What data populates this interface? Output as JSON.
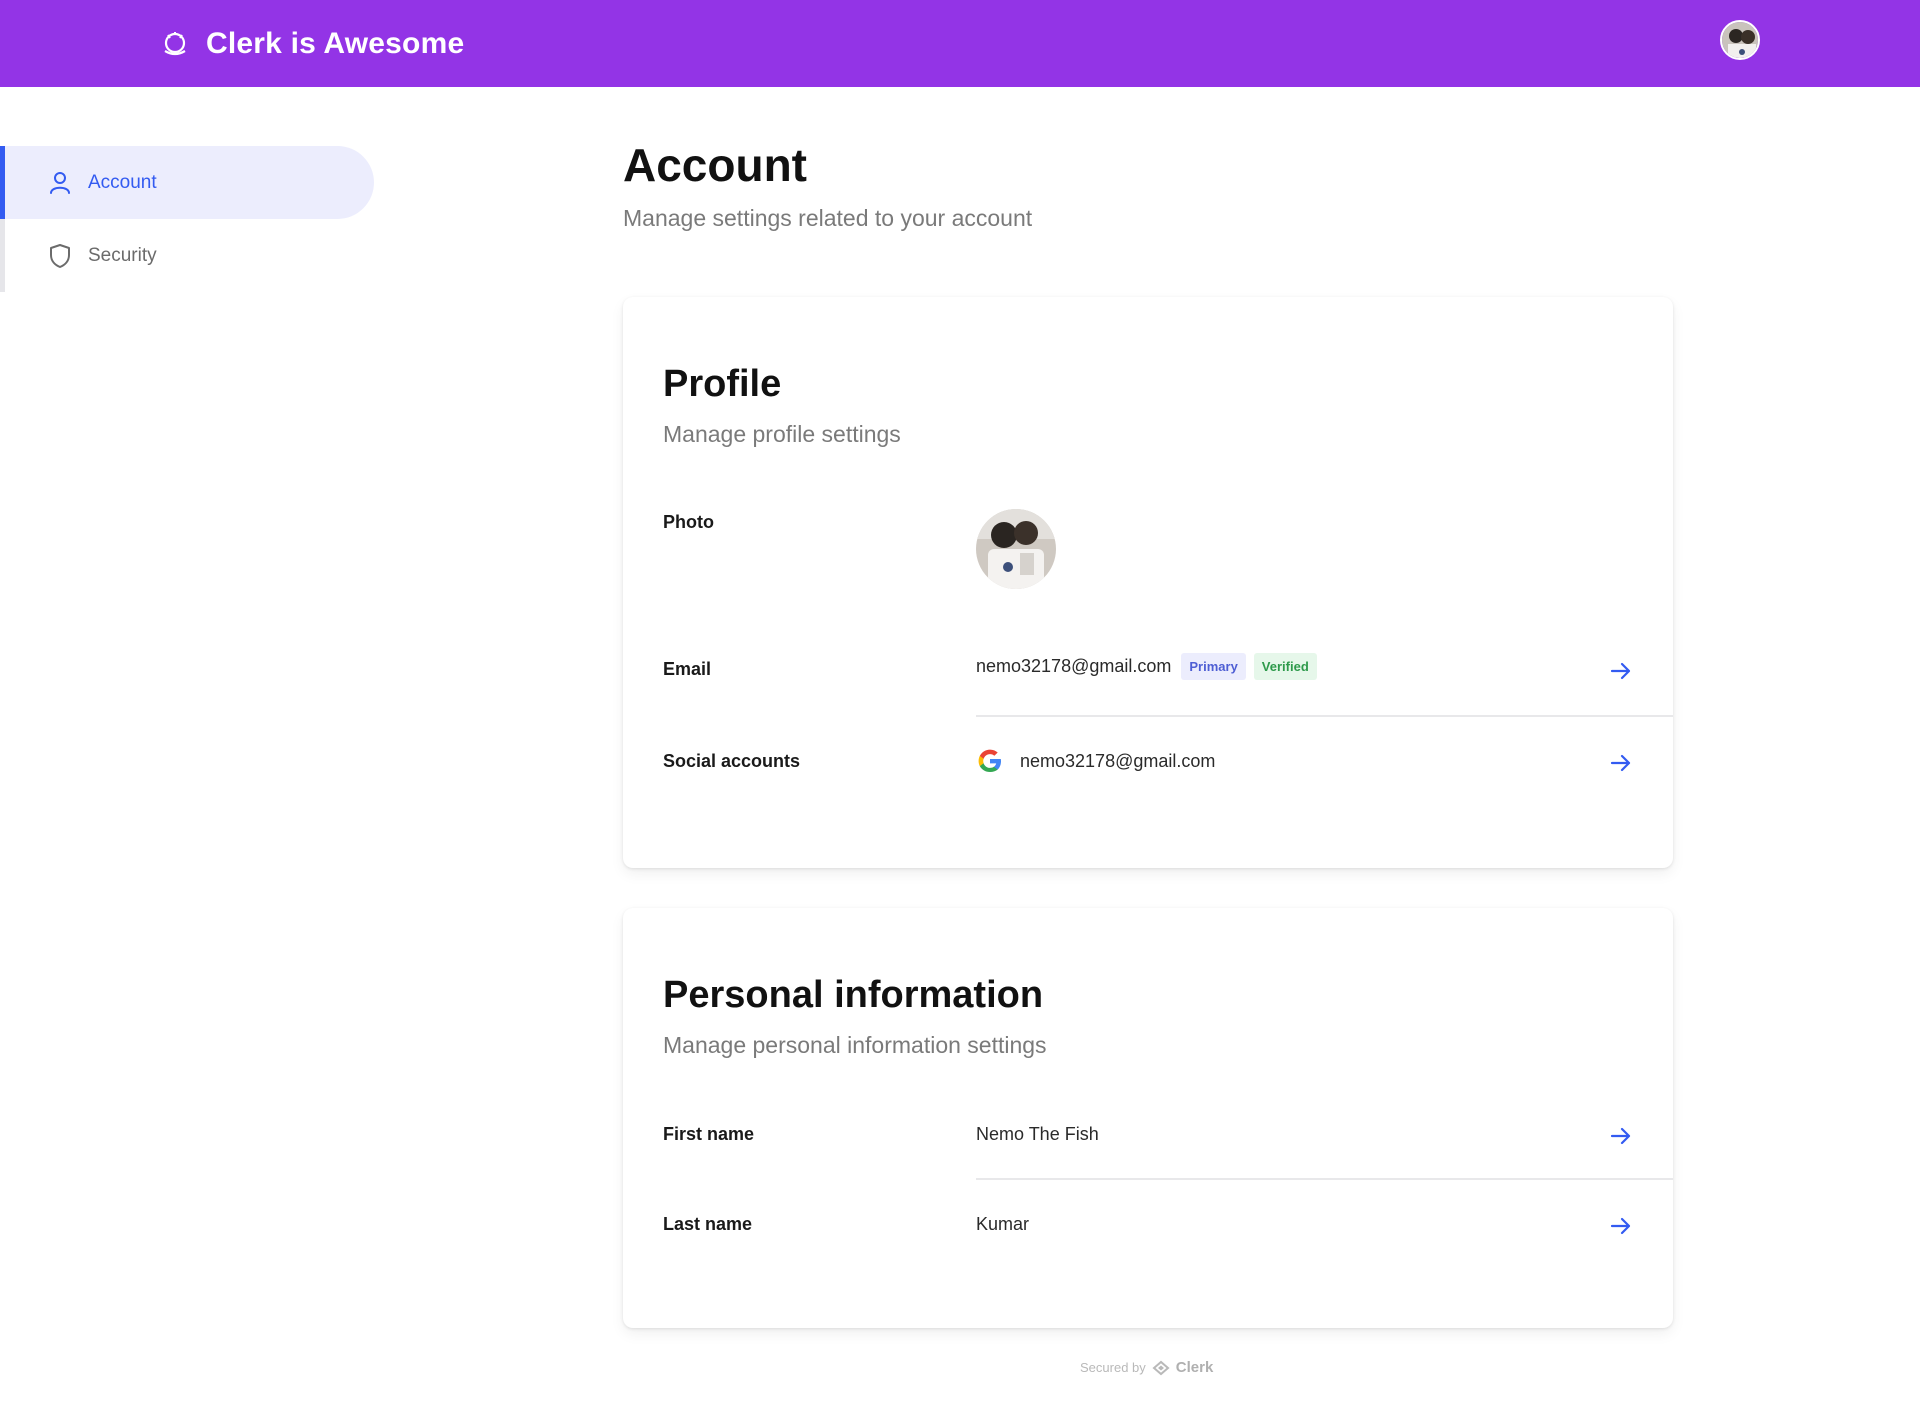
{
  "app": {
    "title": "Clerk is Awesome",
    "accent": "#9334e6",
    "link_color": "#335bf1"
  },
  "header": {
    "avatar_icon": "user-avatar"
  },
  "sidebar": {
    "items": [
      {
        "label": "Account",
        "icon": "user-icon",
        "active": true
      },
      {
        "label": "Security",
        "icon": "shield-icon",
        "active": false
      }
    ]
  },
  "main": {
    "title": "Account",
    "subtitle": "Manage settings related to your account"
  },
  "profile": {
    "title": "Profile",
    "subtitle": "Manage profile settings",
    "photo_label": "Photo",
    "email_label": "Email",
    "email_value": "nemo32178@gmail.com",
    "email_badges": [
      "Primary",
      "Verified"
    ],
    "social_label": "Social accounts",
    "social_value": "nemo32178@gmail.com",
    "social_icon": "google-icon"
  },
  "personal": {
    "title": "Personal information",
    "subtitle": "Manage personal information settings",
    "first_name_label": "First name",
    "first_name_value": "Nemo The Fish",
    "last_name_label": "Last name",
    "last_name_value": "Kumar"
  },
  "footer": {
    "secured_by": "Secured by",
    "brand": "Clerk"
  }
}
